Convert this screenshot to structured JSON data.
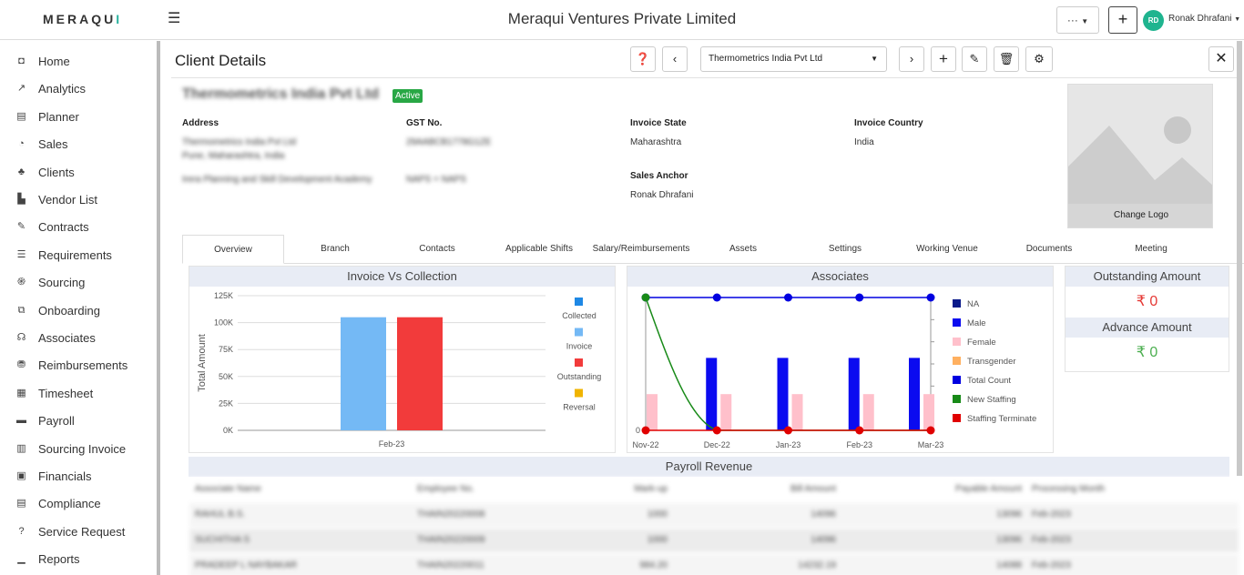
{
  "header": {
    "logo_prefix": "MERAQU",
    "logo_suffix": "I",
    "company_name": "Meraqui Ventures Private Limited",
    "more_label": "···",
    "add_label": "+",
    "user_initials": "RD",
    "user_name": "Ronak Dhrafani"
  },
  "sidebar": {
    "items": [
      {
        "label": "Home",
        "icon": "home-icon",
        "glyph": "◘"
      },
      {
        "label": "Analytics",
        "icon": "chart-line-icon",
        "glyph": "↗"
      },
      {
        "label": "Planner",
        "icon": "clipboard-icon",
        "glyph": "▤"
      },
      {
        "label": "Sales",
        "icon": "pie-chart-icon",
        "glyph": "◔"
      },
      {
        "label": "Clients",
        "icon": "users-icon",
        "glyph": "♣"
      },
      {
        "label": "Vendor List",
        "icon": "industry-icon",
        "glyph": "▙"
      },
      {
        "label": "Contracts",
        "icon": "file-signature-icon",
        "glyph": "✎"
      },
      {
        "label": "Requirements",
        "icon": "list-icon",
        "glyph": "☰"
      },
      {
        "label": "Sourcing",
        "icon": "fingerprint-icon",
        "glyph": "֍"
      },
      {
        "label": "Onboarding",
        "icon": "onboard-icon",
        "glyph": "⧉"
      },
      {
        "label": "Associates",
        "icon": "headset-icon",
        "glyph": "☊"
      },
      {
        "label": "Reimbursements",
        "icon": "money-icon",
        "glyph": "⛃"
      },
      {
        "label": "Timesheet",
        "icon": "calendar-icon",
        "glyph": "▦"
      },
      {
        "label": "Payroll",
        "icon": "payroll-icon",
        "glyph": "▬"
      },
      {
        "label": "Sourcing Invoice",
        "icon": "invoice-icon",
        "glyph": "▥"
      },
      {
        "label": "Financials",
        "icon": "calculator-icon",
        "glyph": "▣"
      },
      {
        "label": "Compliance",
        "icon": "compliance-icon",
        "glyph": "▤"
      },
      {
        "label": "Service Request",
        "icon": "question-circle-icon",
        "glyph": "?"
      },
      {
        "label": "Reports",
        "icon": "bar-chart-icon",
        "glyph": "▁"
      }
    ]
  },
  "page": {
    "title": "Client Details",
    "selected_client": "Thermometrics India Pvt Ltd",
    "close_label": "✕"
  },
  "client": {
    "name": "Thermometrics India Pvt Ltd",
    "status": "Active",
    "address_label": "Address",
    "address_line1": "Thermometrics India Pvt Ltd",
    "address_line2": "Pune, Maharashtra, India",
    "address_line3": "Irera Planning and Skill Development Academy",
    "gst_label": "GST No.",
    "gst_value": "29AABCB1778G1ZE",
    "gst_value2": "NAPS + NAPS",
    "invoice_state_label": "Invoice State",
    "invoice_state": "Maharashtra",
    "invoice_country_label": "Invoice Country",
    "invoice_country": "India",
    "sales_anchor_label": "Sales Anchor",
    "sales_anchor": "Ronak Dhrafani",
    "change_logo": "Change Logo"
  },
  "tabs": [
    "Overview",
    "Branch",
    "Contacts",
    "Applicable Shifts",
    "Salary/Reimbursements",
    "Assets",
    "Settings",
    "Working Venue",
    "Documents",
    "Meeting"
  ],
  "amounts": {
    "outstanding_title": "Outstanding Amount",
    "outstanding_value": "₹ 0",
    "outstanding_color": "#e53935",
    "advance_title": "Advance Amount",
    "advance_value": "₹ 0",
    "advance_color": "#4caf50"
  },
  "payroll": {
    "title": "Payroll Revenue",
    "columns": [
      "Associate Name",
      "Employee No.",
      "Mark-up",
      "Bill Amount",
      "Payable Amount",
      "Processing Month"
    ],
    "rows": [
      [
        "RAHUL B.S.",
        "THAIN20220008",
        "1000",
        "14096",
        "13096",
        "Feb-2023"
      ],
      [
        "SUCHITHA S",
        "THAIN20220009",
        "1000",
        "14096",
        "13096",
        "Feb-2023"
      ],
      [
        "PRADEEP L NAYBAKAR",
        "THAIN20220011",
        "984.20",
        "14232.19",
        "14088",
        "Feb-2023"
      ]
    ]
  },
  "chart_data": [
    {
      "type": "bar",
      "title": "Invoice Vs Collection",
      "ylabel": "Total Amount",
      "xlabel": "",
      "categories": [
        "Feb-23"
      ],
      "yticks": [
        "0K",
        "25K",
        "50K",
        "75K",
        "100K",
        "125K"
      ],
      "ylim": [
        0,
        125000
      ],
      "legend_position": "right",
      "series": [
        {
          "name": "Collected",
          "color": "#1e88e5",
          "values": [
            0
          ]
        },
        {
          "name": "Invoice",
          "color": "#74b9f5",
          "values": [
            105000
          ]
        },
        {
          "name": "Outstanding",
          "color": "#f23b3b",
          "values": [
            105000
          ]
        },
        {
          "name": "Reversal",
          "color": "#f0b400",
          "values": [
            0
          ]
        }
      ]
    },
    {
      "type": "bar",
      "title": "Associates",
      "categories": [
        "Nov-22",
        "Dec-22",
        "Jan-23",
        "Feb-23",
        "Mar-23"
      ],
      "yticks": [
        "0"
      ],
      "legend_position": "right",
      "bar_series": [
        {
          "name": "NA",
          "color": "#0a1a8a",
          "values": [
            0,
            0,
            0,
            0,
            0
          ]
        },
        {
          "name": "Male",
          "color": "#0b0bf0",
          "values": [
            0,
            3,
            3,
            3,
            3
          ]
        },
        {
          "name": "Female",
          "color": "#ffc0cb",
          "values": [
            1.5,
            1.5,
            1.5,
            1.5,
            1.5
          ]
        },
        {
          "name": "Transgender",
          "color": "#ffb060",
          "values": [
            0,
            0,
            0,
            0,
            0
          ]
        }
      ],
      "line_series": [
        {
          "name": "Total Count",
          "color": "#0000e0",
          "values": [
            5.5,
            5.5,
            5.5,
            5.5,
            5.5
          ]
        },
        {
          "name": "New Staffing",
          "color": "#188a18",
          "values": [
            5.5,
            0,
            0,
            0,
            0
          ]
        },
        {
          "name": "Staffing Terminate",
          "color": "#e00000",
          "values": [
            0,
            0,
            0,
            0,
            0
          ]
        }
      ],
      "ylim": [
        0,
        5.5
      ]
    }
  ]
}
